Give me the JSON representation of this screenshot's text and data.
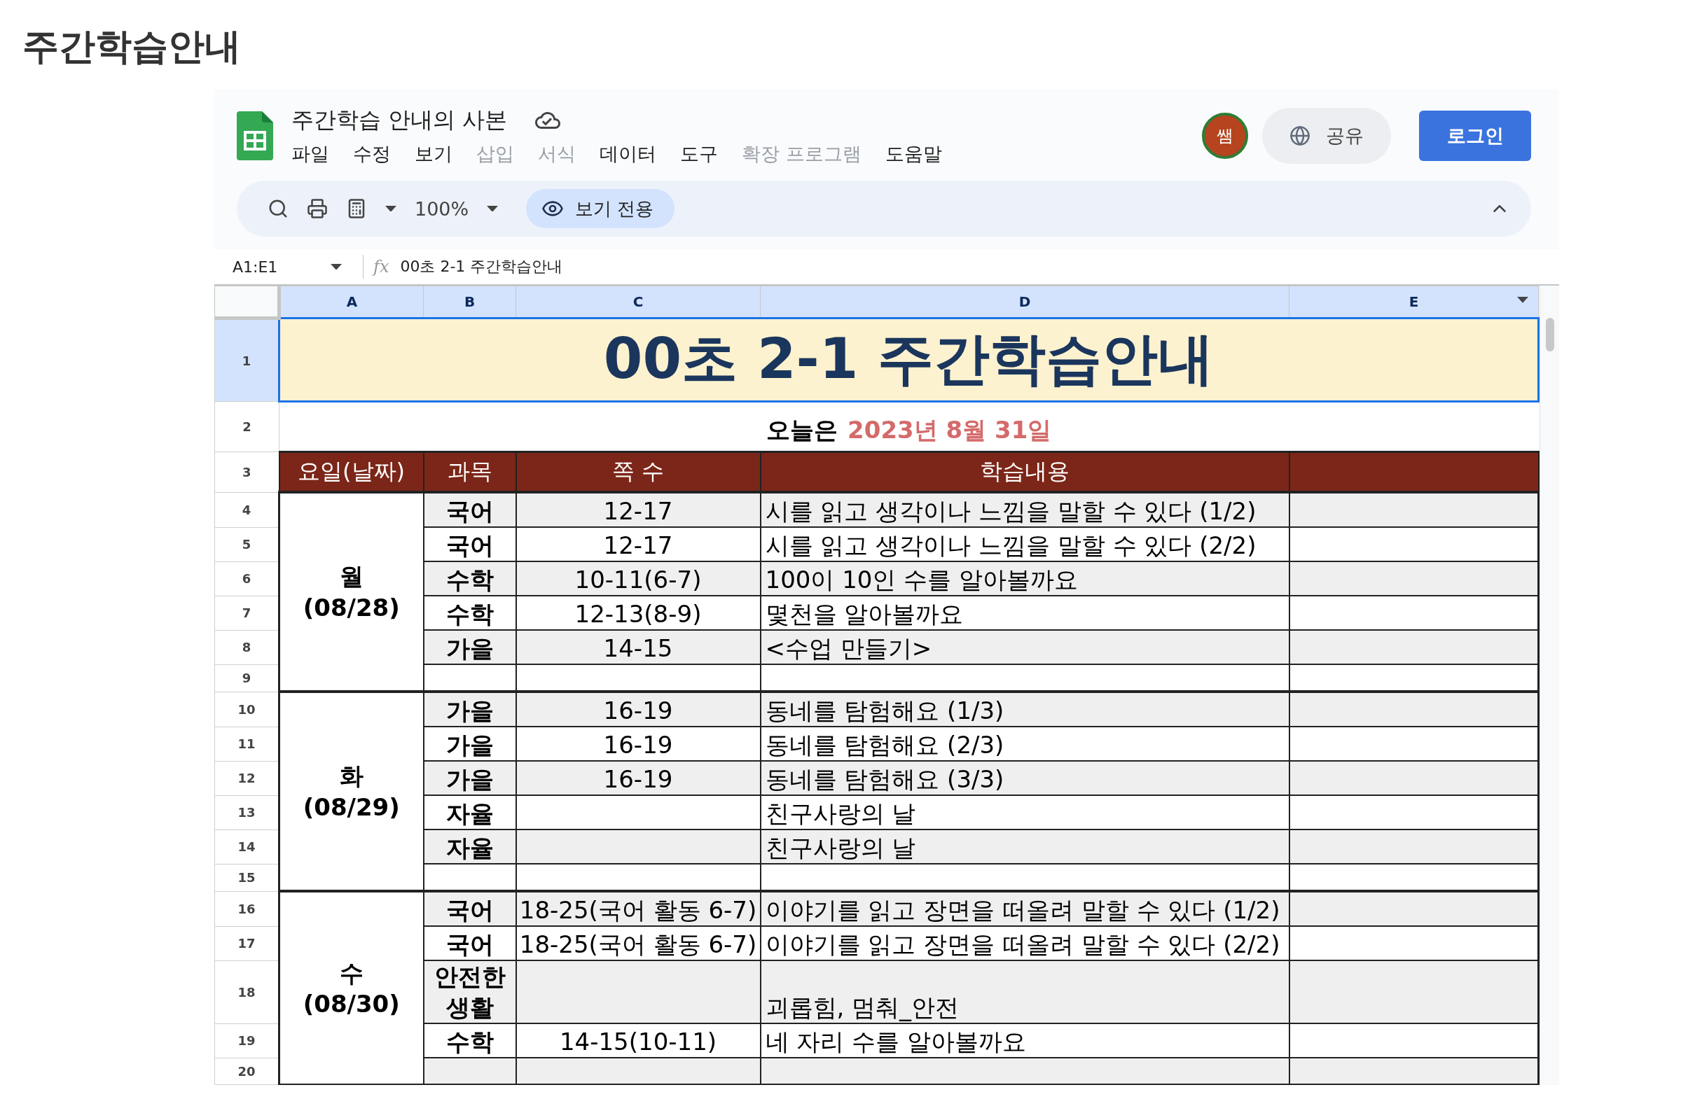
{
  "page_title": "주간학습안내",
  "doc": {
    "title": "주간학습 안내의 사본",
    "avatar": "쌤",
    "share": "공유",
    "login": "로그인"
  },
  "menu": [
    {
      "label": "파일",
      "disabled": false
    },
    {
      "label": "수정",
      "disabled": false
    },
    {
      "label": "보기",
      "disabled": false
    },
    {
      "label": "삽입",
      "disabled": true
    },
    {
      "label": "서식",
      "disabled": true
    },
    {
      "label": "데이터",
      "disabled": false
    },
    {
      "label": "도구",
      "disabled": false
    },
    {
      "label": "확장 프로그램",
      "disabled": true
    },
    {
      "label": "도움말",
      "disabled": false
    }
  ],
  "toolbar": {
    "zoom": "100%",
    "view_only": "보기 전용"
  },
  "formula_bar": {
    "cell_ref": "A1:E1",
    "fx": "fx",
    "value": "00초 2-1 주간학습안내"
  },
  "columns": [
    "A",
    "B",
    "C",
    "D",
    "E"
  ],
  "sheet": {
    "title_row": "1",
    "title": "00초 2-1 주간학습안내",
    "date_row": "2",
    "today_label": "오늘은",
    "today_date": "2023년 8월 31일",
    "header_row": "3",
    "headers": [
      "요일(날짜)",
      "과목",
      "쪽 수",
      "학습내용"
    ],
    "days": [
      {
        "day": "월",
        "date": "(08/28)",
        "rows": [
          {
            "row": "4",
            "subject": "국어",
            "pages": "12-17",
            "content": "시를 읽고 생각이나 느낌을 말할 수 있다 (1/2)"
          },
          {
            "row": "5",
            "subject": "국어",
            "pages": "12-17",
            "content": "시를 읽고 생각이나 느낌을 말할 수 있다 (2/2)"
          },
          {
            "row": "6",
            "subject": "수학",
            "pages": "10-11(6-7)",
            "content": "100이 10인 수를 알아볼까요"
          },
          {
            "row": "7",
            "subject": "수학",
            "pages": "12-13(8-9)",
            "content": "몇천을 알아볼까요"
          },
          {
            "row": "8",
            "subject": "가을",
            "pages": "14-15",
            "content": "<수업 만들기>"
          },
          {
            "row": "9"
          }
        ]
      },
      {
        "day": "화",
        "date": "(08/29)",
        "rows": [
          {
            "row": "10",
            "subject": "가을",
            "pages": "16-19",
            "content": "동네를 탐험해요 (1/3)"
          },
          {
            "row": "11",
            "subject": "가을",
            "pages": "16-19",
            "content": "동네를 탐험해요 (2/3)"
          },
          {
            "row": "12",
            "subject": "가을",
            "pages": "16-19",
            "content": "동네를 탐험해요 (3/3)"
          },
          {
            "row": "13",
            "subject": "자율",
            "content": "친구사랑의 날"
          },
          {
            "row": "14",
            "subject": "자율",
            "content": "친구사랑의 날"
          },
          {
            "row": "15"
          }
        ]
      },
      {
        "day": "수",
        "date": "(08/30)",
        "rows": [
          {
            "row": "16",
            "subject": "국어",
            "pages": "18-25(국어 활동 6-7)",
            "content": "이야기를 읽고 장면을 떠올려 말할 수 있다 (1/2)"
          },
          {
            "row": "17",
            "subject": "국어",
            "pages": "18-25(국어 활동 6-7)",
            "content": "이야기를 읽고 장면을 떠올려 말할 수 있다 (2/2)"
          },
          {
            "row": "18",
            "subject": "안전한 생활",
            "content": "괴롭힘, 멈춰_안전"
          },
          {
            "row": "19",
            "subject": "수학",
            "pages": "14-15(10-11)",
            "content": "네 자리 수를 알아볼까요"
          },
          {
            "row": "20"
          }
        ]
      }
    ]
  }
}
